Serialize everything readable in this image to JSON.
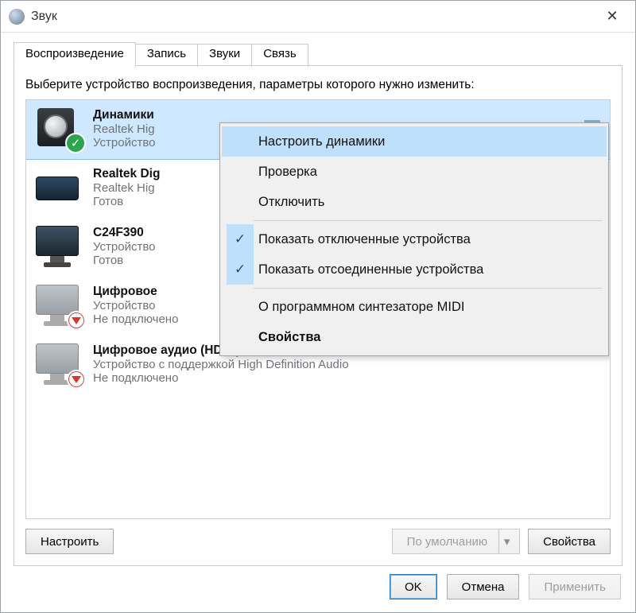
{
  "window": {
    "title": "Звук"
  },
  "tabs": [
    {
      "label": "Воспроизведение",
      "active": true
    },
    {
      "label": "Запись",
      "active": false
    },
    {
      "label": "Звуки",
      "active": false
    },
    {
      "label": "Связь",
      "active": false
    }
  ],
  "instruction": "Выберите устройство воспроизведения, параметры которого нужно изменить:",
  "devices": [
    {
      "title": "Динамики",
      "line2": "Realtek Hig",
      "line3": "Устройство",
      "icon": "speaker",
      "badge": "check",
      "selected": true,
      "level": true
    },
    {
      "title": "Realtek Dig",
      "line2": "Realtek Hig",
      "line3": "Готов",
      "icon": "blackbox",
      "badge": null,
      "selected": false,
      "level": false
    },
    {
      "title": "C24F390",
      "line2": "Устройство",
      "line3": "Готов",
      "icon": "monitor",
      "badge": null,
      "selected": false,
      "level": false
    },
    {
      "title": "Цифровое",
      "line2": "Устройство",
      "line3": "Не подключено",
      "icon": "monitor-gray",
      "badge": "down",
      "selected": false,
      "level": false
    },
    {
      "title": "Цифровое аудио (HDMI)",
      "line2": "Устройство с поддержкой High Definition Audio",
      "line3": "Не подключено",
      "icon": "monitor-gray",
      "badge": "down",
      "selected": false,
      "level": false
    }
  ],
  "context_menu": [
    {
      "label": "Настроить динамики",
      "checked": false,
      "highlight": true,
      "bold": false,
      "sep_after": false
    },
    {
      "label": "Проверка",
      "checked": false,
      "highlight": false,
      "bold": false,
      "sep_after": false
    },
    {
      "label": "Отключить",
      "checked": false,
      "highlight": false,
      "bold": false,
      "sep_after": true
    },
    {
      "label": "Показать отключенные устройства",
      "checked": true,
      "highlight": false,
      "bold": false,
      "sep_after": false
    },
    {
      "label": "Показать отсоединенные устройства",
      "checked": true,
      "highlight": false,
      "bold": false,
      "sep_after": true
    },
    {
      "label": "О программном синтезаторе MIDI",
      "checked": false,
      "highlight": false,
      "bold": false,
      "sep_after": false
    },
    {
      "label": "Свойства",
      "checked": false,
      "highlight": false,
      "bold": true,
      "sep_after": false
    }
  ],
  "panel_buttons": {
    "configure": "Настроить",
    "set_default": "По умолчанию",
    "properties": "Свойства"
  },
  "dialog_buttons": {
    "ok": "OK",
    "cancel": "Отмена",
    "apply": "Применить"
  }
}
